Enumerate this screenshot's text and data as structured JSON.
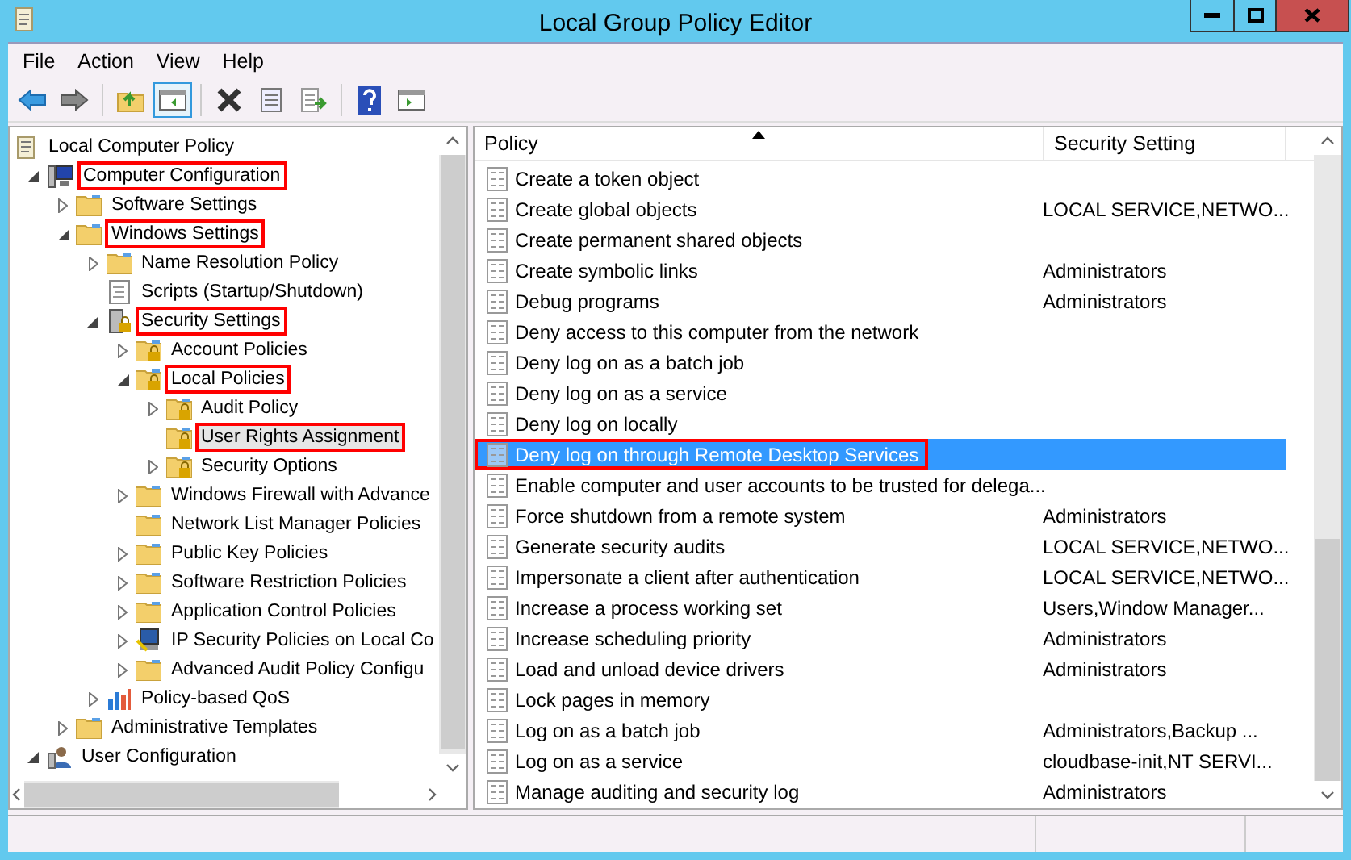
{
  "window": {
    "title": "Local Group Policy Editor"
  },
  "menu": [
    "File",
    "Action",
    "View",
    "Help"
  ],
  "toolbar": [
    {
      "kind": "back",
      "pressed": false
    },
    {
      "kind": "forward",
      "pressed": false
    },
    {
      "kind": "sep"
    },
    {
      "kind": "up",
      "pressed": false
    },
    {
      "kind": "tree",
      "pressed": true
    },
    {
      "kind": "sep"
    },
    {
      "kind": "delete",
      "pressed": false
    },
    {
      "kind": "properties",
      "pressed": false
    },
    {
      "kind": "export",
      "pressed": false
    },
    {
      "kind": "sep"
    },
    {
      "kind": "help",
      "pressed": false
    },
    {
      "kind": "actions",
      "pressed": false
    }
  ],
  "tree": [
    {
      "label": "Local Computer Policy",
      "kind": "policy",
      "selected": false,
      "annotated": false,
      "children": [
        {
          "label": "Computer Configuration",
          "kind": "computer",
          "expanded": true,
          "selected": false,
          "annotated": true,
          "children": [
            {
              "label": "Software Settings",
              "kind": "folder",
              "expanded": false,
              "selected": false,
              "annotated": false
            },
            {
              "label": "Windows Settings",
              "kind": "folder",
              "expanded": true,
              "selected": false,
              "annotated": true,
              "children": [
                {
                  "label": "Name Resolution Policy",
                  "kind": "folder",
                  "expanded": false,
                  "selected": false,
                  "annotated": false
                },
                {
                  "label": "Scripts (Startup/Shutdown)",
                  "kind": "script",
                  "selected": false,
                  "annotated": false
                },
                {
                  "label": "Security Settings",
                  "kind": "security",
                  "expanded": true,
                  "selected": false,
                  "annotated": true,
                  "children": [
                    {
                      "label": "Account Policies",
                      "kind": "lockfolder",
                      "expanded": false,
                      "selected": false,
                      "annotated": false
                    },
                    {
                      "label": "Local Policies",
                      "kind": "lockfolder",
                      "expanded": true,
                      "selected": false,
                      "annotated": true,
                      "children": [
                        {
                          "label": "Audit Policy",
                          "kind": "lockfolder",
                          "expanded": false,
                          "selected": false,
                          "annotated": false
                        },
                        {
                          "label": "User Rights Assignment",
                          "kind": "lockfolder",
                          "selected": true,
                          "annotated": true
                        },
                        {
                          "label": "Security Options",
                          "kind": "lockfolder",
                          "expanded": false,
                          "selected": false,
                          "annotated": false
                        }
                      ]
                    },
                    {
                      "label": "Windows Firewall with Advance",
                      "kind": "folder",
                      "expanded": false,
                      "selected": false,
                      "annotated": false
                    },
                    {
                      "label": "Network List Manager Policies",
                      "kind": "folder",
                      "selected": false,
                      "annotated": false
                    },
                    {
                      "label": "Public Key Policies",
                      "kind": "folder",
                      "expanded": false,
                      "selected": false,
                      "annotated": false
                    },
                    {
                      "label": "Software Restriction Policies",
                      "kind": "folder",
                      "expanded": false,
                      "selected": false,
                      "annotated": false
                    },
                    {
                      "label": "Application Control Policies",
                      "kind": "folder",
                      "expanded": false,
                      "selected": false,
                      "annotated": false
                    },
                    {
                      "label": "IP Security Policies on Local Co",
                      "kind": "ipsec",
                      "expanded": false,
                      "selected": false,
                      "annotated": false
                    },
                    {
                      "label": "Advanced Audit Policy Configu",
                      "kind": "folder",
                      "expanded": false,
                      "selected": false,
                      "annotated": false
                    }
                  ]
                },
                {
                  "label": "Policy-based QoS",
                  "kind": "chart",
                  "expanded": false,
                  "selected": false,
                  "annotated": false
                }
              ]
            },
            {
              "label": "Administrative Templates",
              "kind": "folder",
              "expanded": false,
              "selected": false,
              "annotated": false
            }
          ]
        },
        {
          "label": "User Configuration",
          "kind": "user",
          "expanded": true,
          "selected": false,
          "annotated": false
        }
      ]
    }
  ],
  "table": {
    "columns": [
      "Policy",
      "Security Setting"
    ],
    "rows": [
      {
        "policy": "Create a token object",
        "selected": false,
        "annotated": false
      },
      {
        "policy": "Create global objects",
        "setting": "LOCAL SERVICE,NETWO...",
        "selected": false,
        "annotated": false
      },
      {
        "policy": "Create permanent shared objects",
        "selected": false,
        "annotated": false
      },
      {
        "policy": "Create symbolic links",
        "setting": "Administrators",
        "selected": false,
        "annotated": false
      },
      {
        "policy": "Debug programs",
        "setting": "Administrators",
        "selected": false,
        "annotated": false
      },
      {
        "policy": "Deny access to this computer from the network",
        "selected": false,
        "annotated": false
      },
      {
        "policy": "Deny log on as a batch job",
        "selected": false,
        "annotated": false
      },
      {
        "policy": "Deny log on as a service",
        "selected": false,
        "annotated": false
      },
      {
        "policy": "Deny log on locally",
        "selected": false,
        "annotated": false
      },
      {
        "policy": "Deny log on through Remote Desktop Services",
        "selected": true,
        "annotated": true
      },
      {
        "policy": "Enable computer and user accounts to be trusted for delega...",
        "selected": false,
        "annotated": false
      },
      {
        "policy": "Force shutdown from a remote system",
        "setting": "Administrators",
        "selected": false,
        "annotated": false
      },
      {
        "policy": "Generate security audits",
        "setting": "LOCAL SERVICE,NETWO...",
        "selected": false,
        "annotated": false
      },
      {
        "policy": "Impersonate a client after authentication",
        "setting": "LOCAL SERVICE,NETWO...",
        "selected": false,
        "annotated": false
      },
      {
        "policy": "Increase a process working set",
        "setting": "Users,Window Manager...",
        "selected": false,
        "annotated": false
      },
      {
        "policy": "Increase scheduling priority",
        "setting": "Administrators",
        "selected": false,
        "annotated": false
      },
      {
        "policy": "Load and unload device drivers",
        "setting": "Administrators",
        "selected": false,
        "annotated": false
      },
      {
        "policy": "Lock pages in memory",
        "selected": false,
        "annotated": false
      },
      {
        "policy": "Log on as a batch job",
        "setting": "Administrators,Backup ...",
        "selected": false,
        "annotated": false
      },
      {
        "policy": "Log on as a service",
        "setting": "cloudbase-init,NT SERVI...",
        "selected": false,
        "annotated": false
      },
      {
        "policy": "Manage auditing and security log",
        "setting": "Administrators",
        "selected": false,
        "annotated": false
      }
    ]
  }
}
